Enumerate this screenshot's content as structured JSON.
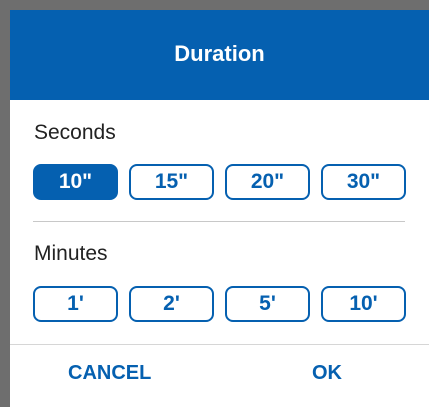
{
  "dialog": {
    "title": "Duration",
    "sections": [
      {
        "label": "Seconds",
        "options": [
          "10\"",
          "15\"",
          "20\"",
          "30\""
        ],
        "selected": "10\""
      },
      {
        "label": "Minutes",
        "options": [
          "1'",
          "2'",
          "5'",
          "10'"
        ],
        "selected": null
      }
    ],
    "actions": {
      "cancel": "CANCEL",
      "ok": "OK"
    }
  },
  "colors": {
    "accent": "#0560b0",
    "overlay": "#6e6e6e",
    "surface": "#ffffff"
  }
}
